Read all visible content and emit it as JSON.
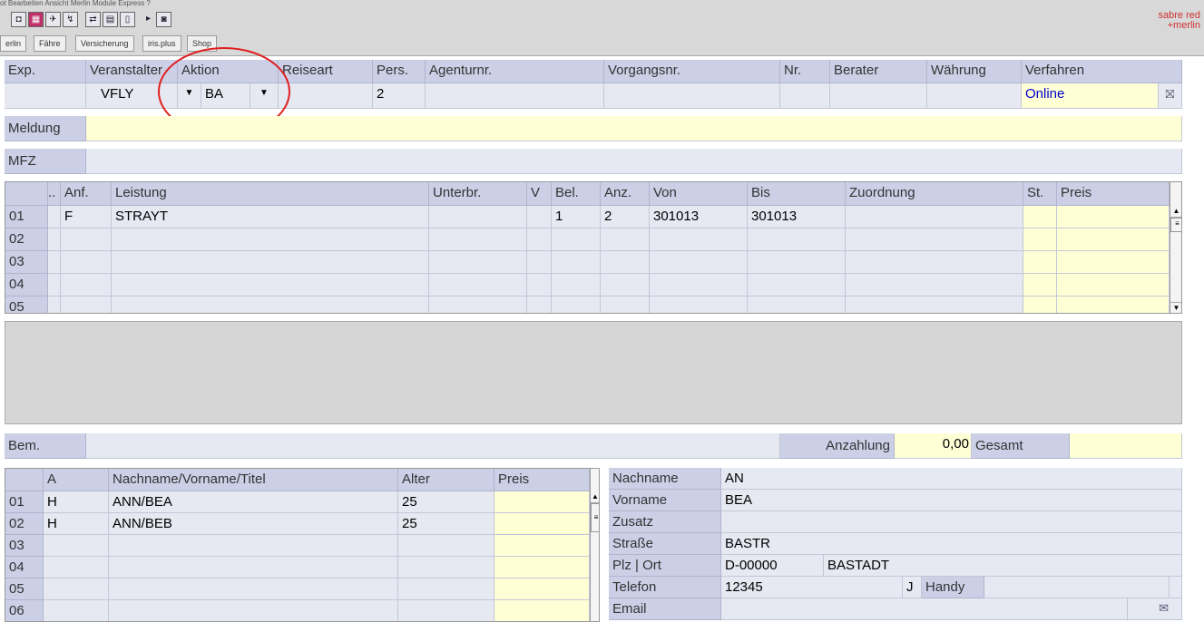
{
  "menu_text": "ot  Bearbeiten  Ansicht  Merlin  Module  Express  ?",
  "toolbar_icons": [
    "camera-icon",
    "film-icon",
    "plus-arrow-icon",
    "route-icon",
    "transfer-icon",
    "save-icon",
    "document-icon",
    "play-icon",
    "camera2-icon"
  ],
  "tabs": [
    "erlin",
    "Fähre",
    "Versicherung",
    "iris.plus",
    "Shop"
  ],
  "brand_line1": "sabre red",
  "brand_line2": "+merlin",
  "booking": {
    "headers": [
      "Exp.",
      "Veranstalter",
      "Aktion",
      "Reiseart",
      "Pers.",
      "Agenturnr.",
      "Vorgangsnr.",
      "Nr.",
      "Berater",
      "Währung",
      "Verfahren"
    ],
    "values": {
      "veranstalter": "VFLY",
      "aktion": "BA",
      "pers": "2",
      "verfahren": "Online"
    }
  },
  "meldung_label": "Meldung",
  "mfz_label": "MFZ",
  "services": {
    "headers": [
      "..",
      "Anf.",
      "Leistung",
      "Unterbr.",
      "V",
      "Bel.",
      "Anz.",
      "Von",
      "Bis",
      "Zuordnung",
      "St.",
      "Preis"
    ],
    "rows": [
      {
        "n": "01",
        "anf": "F",
        "leistung": "STRAYT",
        "bel": "1",
        "anz": "2",
        "von": "301013",
        "bis": "301013"
      },
      {
        "n": "02"
      },
      {
        "n": "03"
      },
      {
        "n": "04"
      },
      {
        "n": "05"
      }
    ]
  },
  "bem_label": "Bem.",
  "anzahlung_label": "Anzahlung",
  "anzahlung_value": "0,00",
  "gesamt_label": "Gesamt",
  "travelers": {
    "headers": [
      "A",
      "Nachname/Vorname/Titel",
      "Alter",
      "Preis"
    ],
    "rows": [
      {
        "n": "01",
        "a": "H",
        "name": "ANN/BEA",
        "alter": "25"
      },
      {
        "n": "02",
        "a": "H",
        "name": "ANN/BEB",
        "alter": "25"
      },
      {
        "n": "03"
      },
      {
        "n": "04"
      },
      {
        "n": "05"
      },
      {
        "n": "06"
      }
    ]
  },
  "customer": {
    "nachname_label": "Nachname",
    "nachname": "AN",
    "vorname_label": "Vorname",
    "vorname": "BEA",
    "zusatz_label": "Zusatz",
    "strasse_label": "Straße",
    "strasse": "BASTR",
    "plz_label": "Plz | Ort",
    "plz": "D-00000",
    "ort": "BASTADT",
    "telefon_label": "Telefon",
    "telefon": "12345",
    "j": "J",
    "handy_label": "Handy",
    "email_label": "Email"
  },
  "colors": {
    "header": "#ccd0e7",
    "cell": "#e6e8f2",
    "highlight": "#ffffd6",
    "annotation": "#e02020",
    "link": "#0000cc"
  }
}
